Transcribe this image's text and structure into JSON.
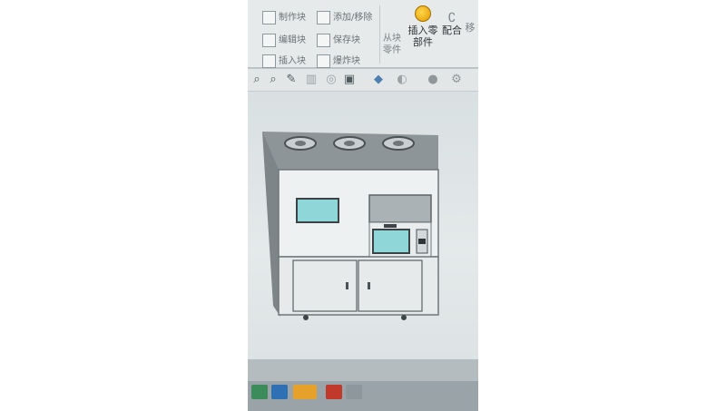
{
  "ribbon": {
    "make_block": "制作块",
    "add_remove": "添加/移除",
    "edit_block": "编辑块",
    "save_block": "保存块",
    "insert_block": "插入块",
    "explode_block": "爆炸块",
    "from_block_part": "从块零件",
    "insert_part": "插入零部件",
    "mate": "配合",
    "move": "移"
  },
  "toolbar": {
    "icons": [
      "zoom-fit-icon",
      "zoom-area-icon",
      "previous-view-icon",
      "section-view-icon",
      "view-orientation-icon",
      "display-style-icon",
      "hide-show-icon",
      "appearance-icon",
      "scene-icon",
      "view-settings-icon"
    ]
  },
  "taskbar": {
    "icons": [
      "app-icon-1",
      "app-icon-2",
      "app-icon-3",
      "app-icon-4",
      "app-icon-5"
    ]
  },
  "colors": {
    "ribbon_bg": "#e7eaeb",
    "viewport_bg": "#e0e6e7",
    "screen_cyan": "#8fd6d9",
    "cabinet_body": "#eef1f1"
  }
}
